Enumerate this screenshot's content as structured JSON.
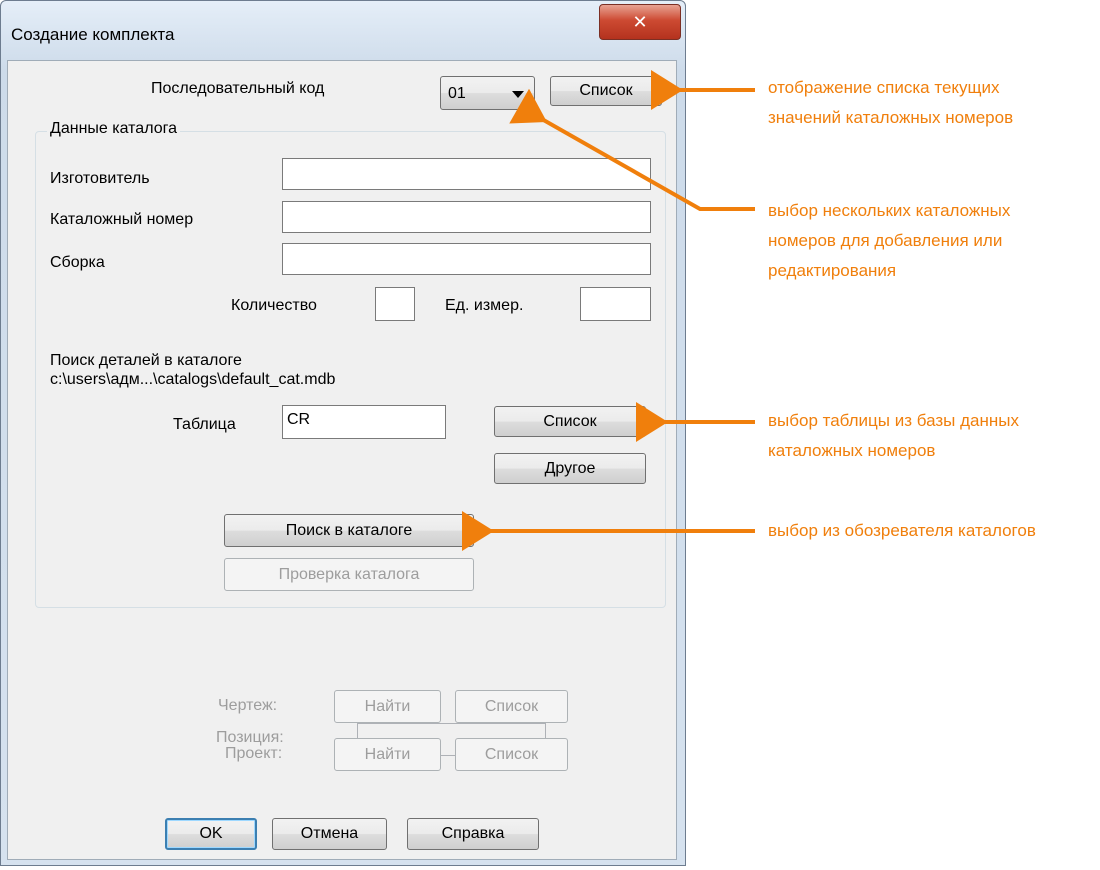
{
  "window": {
    "title": "Создание комплекта",
    "close_glyph": "✕"
  },
  "sequential": {
    "label": "Последовательный код",
    "value": "01",
    "list_button": "Список"
  },
  "catalog_group": {
    "title": "Данные каталога",
    "manufacturer_label": "Изготовитель",
    "manufacturer_value": "",
    "catalog_number_label": "Каталожный номер",
    "catalog_number_value": "",
    "assembly_label": "Сборка",
    "assembly_value": "",
    "quantity_label": "Количество",
    "quantity_value": "",
    "unit_label": "Ед. измер.",
    "unit_value": "",
    "lookup_title": "Поиск деталей в каталоге",
    "lookup_path": "c:\\users\\адм...\\catalogs\\default_cat.mdb",
    "table_label": "Таблица",
    "table_value": "CR",
    "table_list_button": "Список",
    "other_button": "Другое",
    "catalog_search_button": "Поиск в каталоге",
    "catalog_check_button": "Проверка каталога"
  },
  "position": {
    "position_label": "Позиция:",
    "position_value": "",
    "drawing_label": "Чертеж:",
    "drawing_find": "Найти",
    "drawing_list": "Список",
    "project_label": "Проект:",
    "project_find": "Найти",
    "project_list": "Список"
  },
  "footer": {
    "ok": "OK",
    "cancel": "Отмена",
    "help": "Справка"
  },
  "annotations": {
    "note1": [
      "отображение списка текущих",
      "значений каталожных номеров"
    ],
    "note2": [
      "выбор нескольких каталожных",
      "номеров для добавления или",
      "редактирования"
    ],
    "note3": [
      "выбор таблицы из базы данных",
      "каталожных номеров"
    ],
    "note4": [
      "выбор из обозревателя каталогов"
    ]
  },
  "colors": {
    "annotation": "#f07f0c",
    "close_button": "#c8452f",
    "default_button_border": "#3c7fb1"
  }
}
